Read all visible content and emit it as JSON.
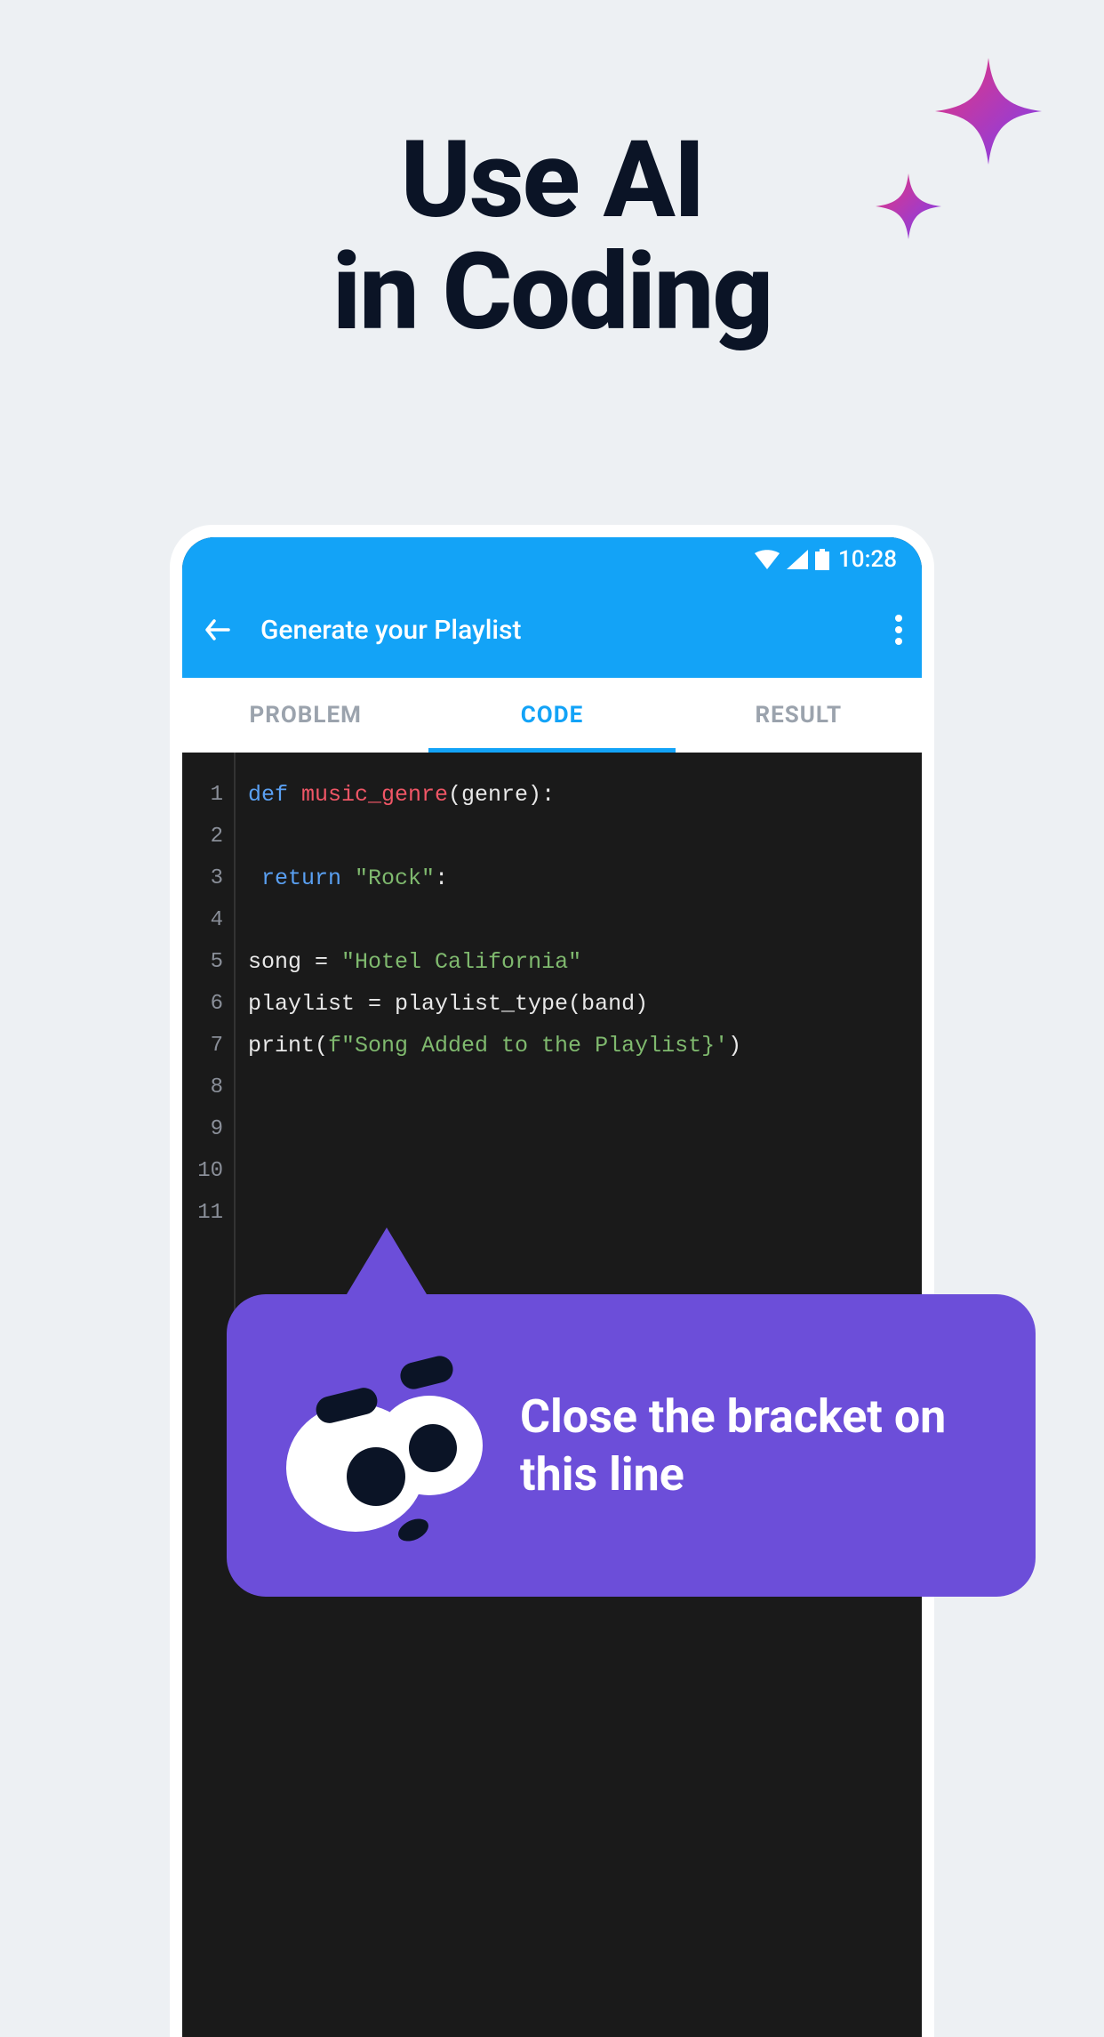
{
  "headline": {
    "line1": "Use AI",
    "line2": "in Coding"
  },
  "status": {
    "time": "10:28"
  },
  "appbar": {
    "title": "Generate your Playlist"
  },
  "tabs": [
    {
      "label": "PROBLEM",
      "active": false
    },
    {
      "label": "CODE",
      "active": true
    },
    {
      "label": "RESULT",
      "active": false
    }
  ],
  "code": {
    "line_numbers": [
      "1",
      "2",
      "3",
      "4",
      "5",
      "6",
      "7",
      "8",
      "9",
      "10",
      "11"
    ],
    "lines": [
      {
        "segments": [
          {
            "t": "def ",
            "c": "kw"
          },
          {
            "t": "music_genre",
            "c": "fn"
          },
          {
            "t": "(genre):",
            "c": ""
          }
        ]
      },
      {
        "segments": []
      },
      {
        "segments": [
          {
            "t": " ",
            "c": ""
          },
          {
            "t": "return",
            "c": "kw"
          },
          {
            "t": " ",
            "c": ""
          },
          {
            "t": "\"Rock\"",
            "c": "str"
          },
          {
            "t": ":",
            "c": ""
          }
        ]
      },
      {
        "segments": []
      },
      {
        "segments": [
          {
            "t": "song = ",
            "c": ""
          },
          {
            "t": "\"Hotel California\"",
            "c": "str"
          }
        ]
      },
      {
        "segments": [
          {
            "t": "playlist = playlist_type(band)",
            "c": ""
          }
        ]
      },
      {
        "segments": [
          {
            "t": "print(",
            "c": ""
          },
          {
            "t": "f\"Song Added to the Playlist}'",
            "c": "str"
          },
          {
            "t": ")",
            "c": ""
          }
        ]
      },
      {
        "segments": []
      },
      {
        "segments": []
      },
      {
        "segments": []
      },
      {
        "segments": []
      }
    ]
  },
  "tooltip": {
    "text": "Close the bracket on this line"
  }
}
